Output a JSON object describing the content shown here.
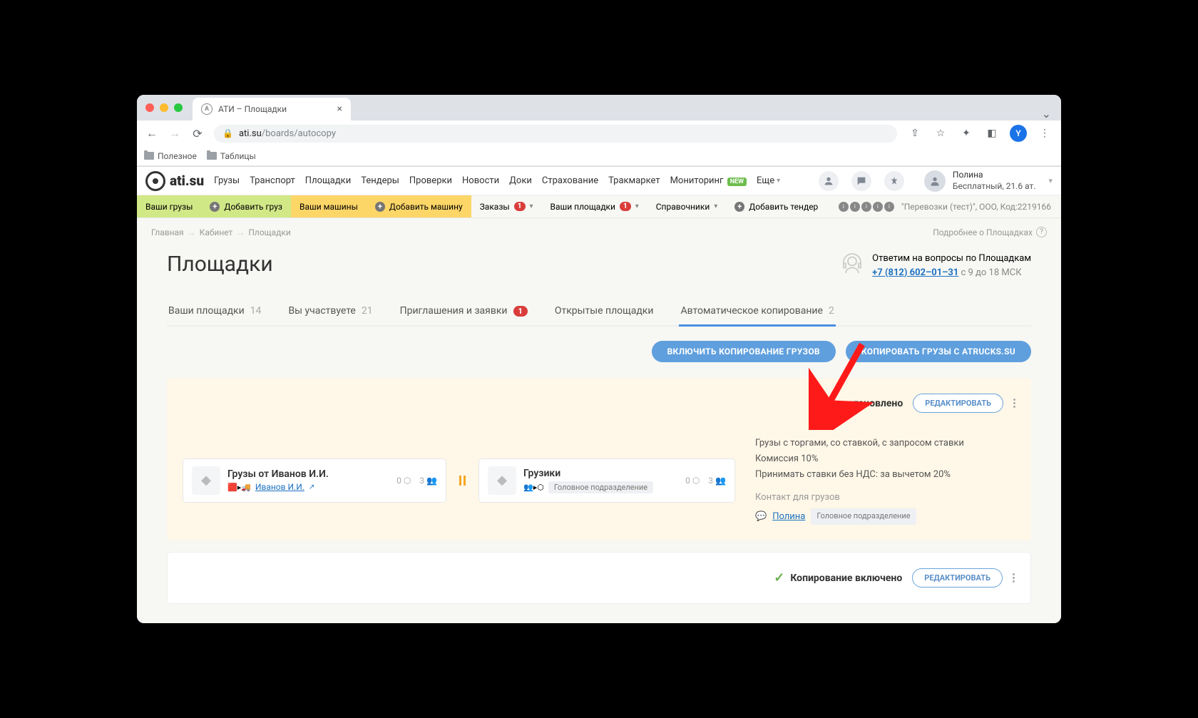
{
  "browser": {
    "tab_title": "АТИ – Площадки",
    "url_host": "ati.su",
    "url_path": "/boards/autocopy",
    "bookmarks": [
      "Полезное",
      "Таблицы"
    ],
    "profile_letter": "Y"
  },
  "header": {
    "logo_text": "ati.su",
    "nav": [
      "Грузы",
      "Транспорт",
      "Площадки",
      "Тендеры",
      "Проверки",
      "Новости",
      "Доки",
      "Страхование",
      "Тракмаркет"
    ],
    "monitoring": "Мониторинг",
    "monitoring_badge": "NEW",
    "more": "Еще",
    "user_name": "Полина",
    "user_plan": "Бесплатный,",
    "user_balance": "21.6 ат."
  },
  "subbar": {
    "your_cargo": "Ваши грузы",
    "add_cargo": "Добавить груз",
    "your_machines": "Ваши машины",
    "add_machine": "Добавить машину",
    "orders": "Заказы",
    "orders_cnt": "1",
    "your_boards": "Ваши площадки",
    "your_boards_cnt": "1",
    "refs": "Справочники",
    "add_tender": "Добавить тендер",
    "company": "\"Перевозки (тест)\", ООО,",
    "company_code": "Код:2219166"
  },
  "breadcrumb": {
    "home": "Главная",
    "cabinet": "Кабинет",
    "board": "Площадки",
    "about": "Подробнее о Площадках"
  },
  "page": {
    "title": "Площадки",
    "help_title": "Ответим на вопросы по Площадкам",
    "help_phone": "+7 (812) 602–01–31",
    "help_hours": "с 9 до 18 МСК"
  },
  "tabs": {
    "t1": "Ваши площадки",
    "c1": "14",
    "t2": "Вы участвуете",
    "c2": "21",
    "t3": "Приглашения и заявки",
    "c3": "1",
    "t4": "Открытые площадки",
    "t5": "Автоматическое копирование",
    "c5": "2"
  },
  "buttons": {
    "enable_copy": "ВКЛЮЧИТЬ КОПИРОВАНИЕ ГРУЗОВ",
    "copy_atrucks": "КОПИРОВАТЬ ГРУЗЫ С ATRUCKS.SU",
    "edit": "РЕДАКТИРОВАТЬ"
  },
  "card1": {
    "status": "Приостановлено",
    "src_title": "Грузы от Иванов И.И.",
    "src_owner": "Иванов И.И.",
    "src_stat1": "0",
    "src_stat2": "3",
    "dst_title": "Грузики",
    "dst_tag": "Головное подразделение",
    "dst_stat1": "0",
    "dst_stat2": "3",
    "info1": "Грузы с торгами, со ставкой, с запросом ставки",
    "info2": "Комиссия 10%",
    "info3": "Принимать ставки без НДС: за вычетом 20%",
    "contact_label": "Контакт для грузов",
    "contact_name": "Полина",
    "contact_dept": "Головное подразделение"
  },
  "card2": {
    "status": "Копирование включено"
  }
}
